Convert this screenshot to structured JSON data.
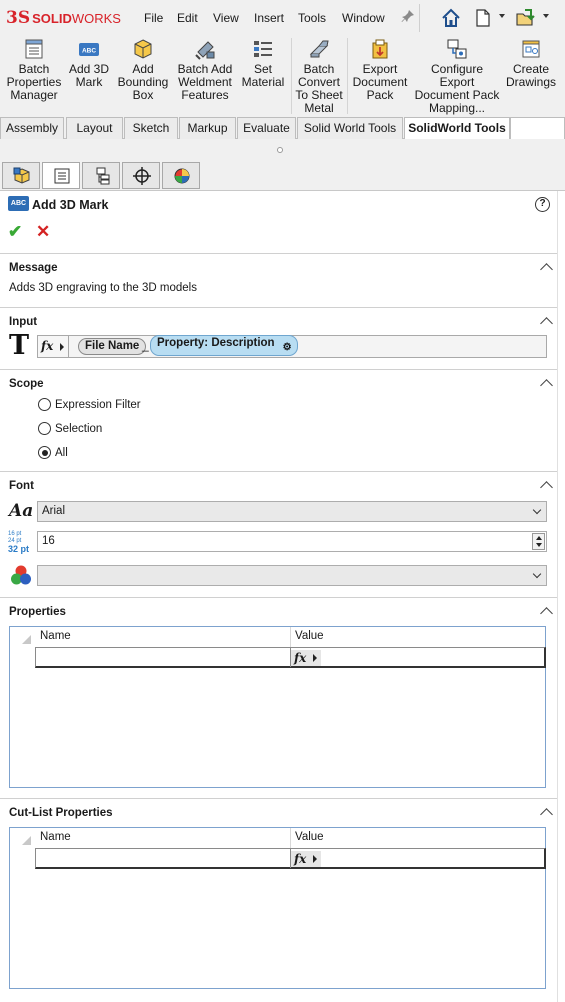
{
  "app": {
    "logo_ds": "3S",
    "logo_solid": "SOLID",
    "logo_works": "WORKS"
  },
  "menu": {
    "items": [
      "File",
      "Edit",
      "View",
      "Insert",
      "Tools",
      "Window"
    ]
  },
  "quick_access": {
    "icons": [
      "home-icon",
      "new-document-icon",
      "open-document-icon"
    ]
  },
  "commands": [
    {
      "label": "Batch Properties Manager",
      "lines": [
        "Batch",
        "Properties",
        "Manager"
      ],
      "icon": "properties-manager-icon"
    },
    {
      "label": "Add 3D Mark",
      "lines": [
        "Add 3D",
        "Mark"
      ],
      "icon": "abc-mark-icon"
    },
    {
      "label": "Add Bounding Box",
      "lines": [
        "Add",
        "Bounding",
        "Box"
      ],
      "icon": "bounding-box-icon"
    },
    {
      "label": "Batch Add Weldment Features",
      "lines": [
        "Batch Add",
        "Weldment",
        "Features"
      ],
      "icon": "weldment-icon"
    },
    {
      "label": "Set Material",
      "lines": [
        "Set",
        "Material"
      ],
      "icon": "material-list-icon"
    },
    {
      "label": "Batch Convert To Sheet Metal",
      "lines": [
        "Batch",
        "Convert",
        "To Sheet",
        "Metal"
      ],
      "icon": "sheet-metal-icon"
    },
    {
      "label": "Export Document Pack",
      "lines": [
        "Export",
        "Document",
        "Pack"
      ],
      "icon": "export-pack-icon"
    },
    {
      "label": "Configure Export Document Pack Mapping...",
      "lines": [
        "Configure",
        "Export",
        "Document Pack",
        "Mapping..."
      ],
      "icon": "configure-mapping-icon"
    },
    {
      "label": "Create Drawings",
      "lines": [
        "Create",
        "Drawings"
      ],
      "icon": "create-drawings-icon"
    }
  ],
  "tabs": [
    "Assembly",
    "Layout",
    "Sketch",
    "Markup",
    "Evaluate",
    "Solid World Tools",
    "SolidWorld Tools"
  ],
  "active_tab": "SolidWorld Tools",
  "pm": {
    "icon_text": "ABC",
    "title": "Add 3D Mark",
    "help": "?",
    "ok": "✔",
    "cancel": "✕",
    "message": {
      "title": "Message",
      "text": "Adds 3D engraving to the 3D models"
    },
    "input": {
      "title": "Input",
      "big_icon": "T",
      "fx": "fx",
      "token_file": "File Name",
      "token_sep": "_",
      "token_property": "Property: Description"
    },
    "scope": {
      "title": "Scope",
      "options": [
        "Expression Filter",
        "Selection",
        "All"
      ],
      "selected": "All"
    },
    "font": {
      "title": "Font",
      "aa_icon": "Aa",
      "font_value": "Arial",
      "size_icon": [
        "16 pt",
        "24 pt",
        "32 pt"
      ],
      "size_value": "16",
      "color_value": ""
    },
    "properties": {
      "title": "Properties",
      "col_name": "Name",
      "col_value": "Value",
      "fx": "fx"
    },
    "cutlist": {
      "title": "Cut-List Properties",
      "col_name": "Name",
      "col_value": "Value",
      "fx": "fx"
    }
  }
}
